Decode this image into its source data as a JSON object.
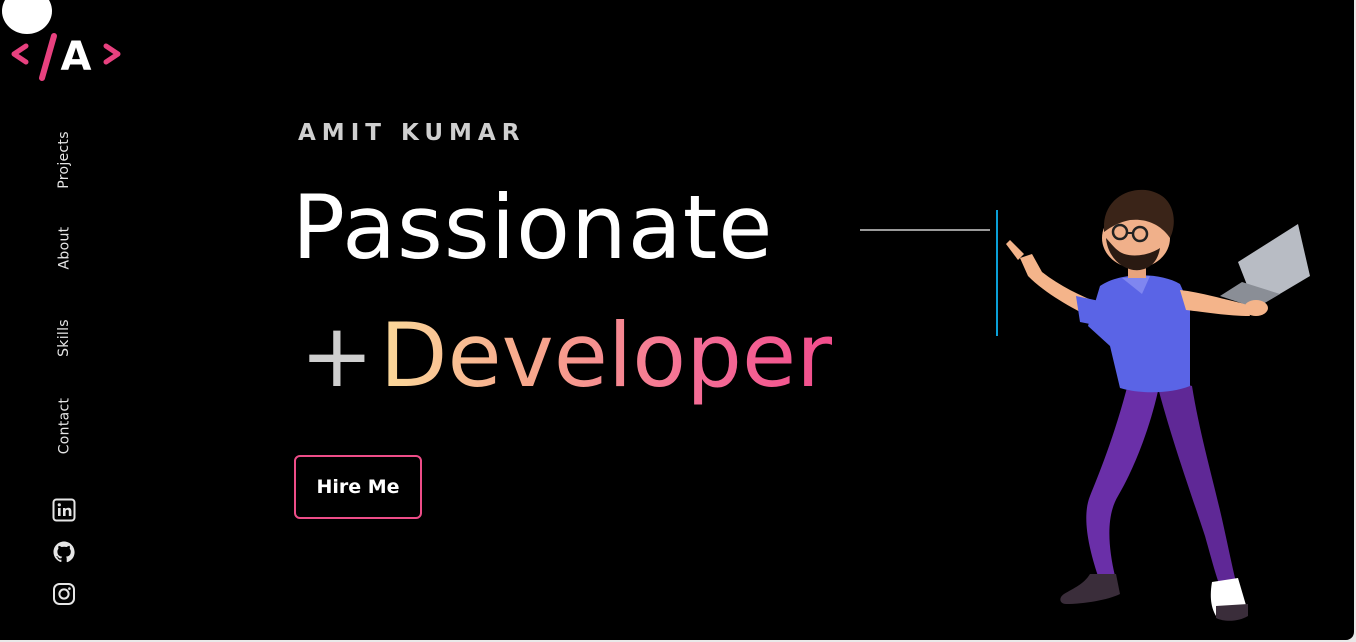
{
  "brand": {
    "logo_letter": "A",
    "accent": "#e8417f"
  },
  "side_nav": {
    "items": [
      {
        "label": "Projects"
      },
      {
        "label": "About"
      },
      {
        "label": "Skills"
      },
      {
        "label": "Contact"
      }
    ]
  },
  "social": [
    {
      "icon": "linkedin-icon"
    },
    {
      "icon": "github-icon"
    },
    {
      "icon": "instagram-icon"
    }
  ],
  "hero": {
    "eyebrow": "AMIT KUMAR",
    "headline": "Passionate",
    "plus": "+",
    "role": "Developer",
    "cta_label": "Hire Me"
  },
  "colors": {
    "background": "#000000",
    "text": "#ffffff",
    "muted": "#cfcfcf",
    "gradient_start": "#fbd99a",
    "gradient_end": "#f24d8c",
    "button_border": "#ee4d88"
  }
}
